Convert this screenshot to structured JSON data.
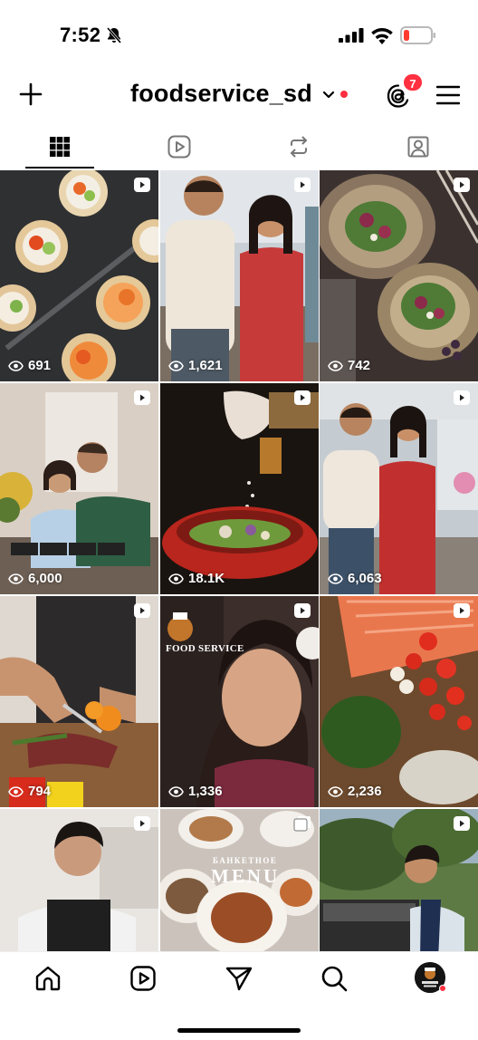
{
  "status_bar": {
    "time": "7:52",
    "icons": [
      "bell-slash-icon",
      "signal-icon",
      "wifi-icon",
      "battery-low-icon"
    ],
    "battery_color": "#ff3b30"
  },
  "header": {
    "username": "foodservice_sd",
    "threads_badge_count": "7",
    "icons": [
      "plus-icon",
      "chevron-down-icon",
      "threads-icon",
      "menu-icon"
    ],
    "accent_color": "#ff3040"
  },
  "tabs": [
    {
      "name": "grid",
      "icon": "grid-icon",
      "active": true
    },
    {
      "name": "reels",
      "icon": "reels-icon",
      "active": false
    },
    {
      "name": "reposts",
      "icon": "repost-icon",
      "active": false
    },
    {
      "name": "tagged",
      "icon": "tagged-icon",
      "active": false
    }
  ],
  "posts": [
    {
      "views": "691",
      "kind": "reel",
      "subject": "appetizer tartlets on slate"
    },
    {
      "views": "1,621",
      "kind": "reel",
      "subject": "couple in kitchen"
    },
    {
      "views": "742",
      "kind": "reel",
      "subject": "fig salad plates"
    },
    {
      "views": "6,000",
      "kind": "reel",
      "subject": "couple at kitchen counter"
    },
    {
      "views": "18.1K",
      "kind": "reel",
      "subject": "seasoning a salad bowl"
    },
    {
      "views": "6,063",
      "kind": "reel",
      "subject": "couple by window"
    },
    {
      "views": "794",
      "kind": "reel",
      "subject": "chef slicing steak"
    },
    {
      "views": "1,336",
      "kind": "reel",
      "subject": "woman smiling",
      "overlay_text": "FOOD SERVICE"
    },
    {
      "views": "2,236",
      "kind": "reel",
      "subject": "salmon and tomatoes"
    },
    {
      "views": "",
      "kind": "reel",
      "subject": "chef portrait"
    },
    {
      "views": "",
      "kind": "carousel",
      "subject": "banquet menu plates",
      "overlay_text_small": "БАНКЕТНОЕ",
      "overlay_text_large": "MENU"
    },
    {
      "views": "",
      "kind": "reel",
      "subject": "chef at outdoor grill"
    }
  ],
  "bottom_nav": [
    {
      "name": "home",
      "icon": "home-icon"
    },
    {
      "name": "reels",
      "icon": "reels-icon"
    },
    {
      "name": "messages",
      "icon": "paper-plane-icon"
    },
    {
      "name": "search",
      "icon": "search-icon"
    },
    {
      "name": "profile",
      "icon": "profile-avatar"
    }
  ]
}
